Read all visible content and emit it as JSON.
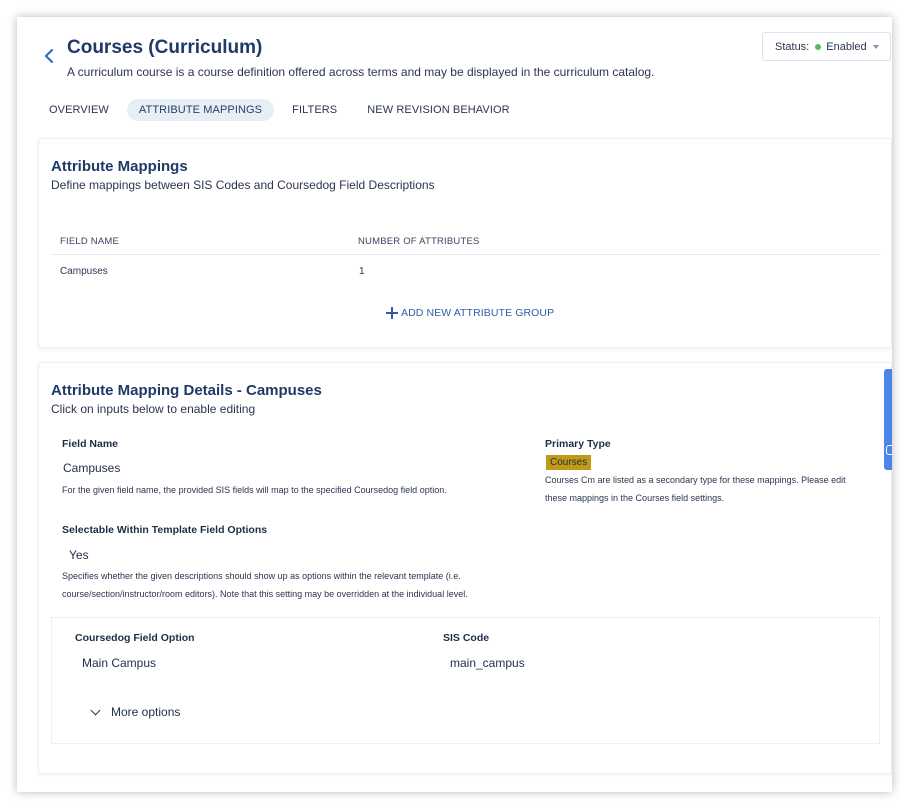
{
  "header": {
    "title": "Courses (Curriculum)",
    "subtitle": "A curriculum course is a course definition offered across terms and may be displayed in the curriculum catalog.",
    "status_label": "Status:",
    "status_value": "Enabled",
    "status_color": "#5cb85c"
  },
  "tabs": [
    {
      "label": "OVERVIEW",
      "active": false
    },
    {
      "label": "ATTRIBUTE MAPPINGS",
      "active": true
    },
    {
      "label": "FILTERS",
      "active": false
    },
    {
      "label": "NEW REVISION BEHAVIOR",
      "active": false
    }
  ],
  "mappings": {
    "title": "Attribute Mappings",
    "description": "Define mappings between SIS Codes and Coursedog Field Descriptions",
    "columns": [
      "FIELD NAME",
      "NUMBER OF ATTRIBUTES"
    ],
    "rows": [
      {
        "field_name": "Campuses",
        "count": "1"
      }
    ],
    "add_button": "ADD NEW ATTRIBUTE GROUP"
  },
  "details": {
    "title": "Attribute Mapping Details - Campuses",
    "description": "Click on inputs below to enable editing",
    "field_name_label": "Field Name",
    "field_name_value": "Campuses",
    "field_name_help": "For the given field name, the provided SIS fields will map to the specified Coursedog field option.",
    "primary_type_label": "Primary Type",
    "primary_type_value": "Courses",
    "primary_type_help_1": "Courses Cm are listed as a secondary type for these mappings. Please edit",
    "primary_type_help_2": "these mappings in the Courses field settings.",
    "selectable_label": "Selectable Within Template Field Options",
    "selectable_value": "Yes",
    "selectable_help_1": "Specifies whether the given descriptions should show up as options within the relevant template (i.e.",
    "selectable_help_2": "course/section/instructor/room editors). Note that this setting may be overridden at the individual level.",
    "option_label": "Coursedog Field Option",
    "option_value": "Main Campus",
    "sis_label": "SIS Code",
    "sis_value": "main_campus",
    "more_options": "More options"
  },
  "colors": {
    "accent": "#2e5fa8",
    "badge": "#c29a16",
    "tab_active_bg": "#e6eef6",
    "side_tab": "#4a86e8"
  }
}
